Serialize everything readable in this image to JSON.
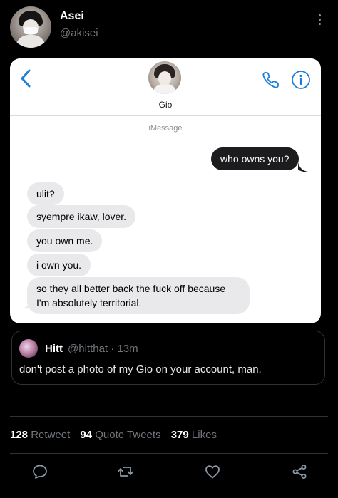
{
  "tweet": {
    "author_name": "Asei",
    "author_handle": "@akisei",
    "avatar_icon": "user-avatar",
    "more_icon": "more-vertical-icon"
  },
  "screenshot": {
    "contact_name": "Gio",
    "service_label": "iMessage",
    "accent_color": "#1a7ddb",
    "messages": [
      {
        "side": "outgoing",
        "text": "who owns you?"
      },
      {
        "side": "incoming",
        "text": "ulit?"
      },
      {
        "side": "incoming",
        "text": "syempre ikaw, lover."
      },
      {
        "side": "incoming",
        "text": "you own me."
      },
      {
        "side": "incoming",
        "text": "i own you."
      },
      {
        "side": "incoming",
        "text": "so they all better back the fuck off because I'm absolutely territorial."
      }
    ]
  },
  "quote_tweet": {
    "name": "Hitt",
    "meta": "@hitthat · 13m",
    "text": "don't post a photo of my Gio on your account, man."
  },
  "stats": {
    "retweets": "128",
    "retweets_label": "Retweet",
    "quotes": "94",
    "quotes_label": "Quote Tweets",
    "likes": "379",
    "likes_label": "Likes"
  },
  "actions": [
    "reply-icon",
    "retweet-icon",
    "like-icon",
    "share-icon"
  ],
  "colors": {
    "background": "#000000",
    "secondary_text": "#71767b",
    "divider": "#2f3336"
  }
}
